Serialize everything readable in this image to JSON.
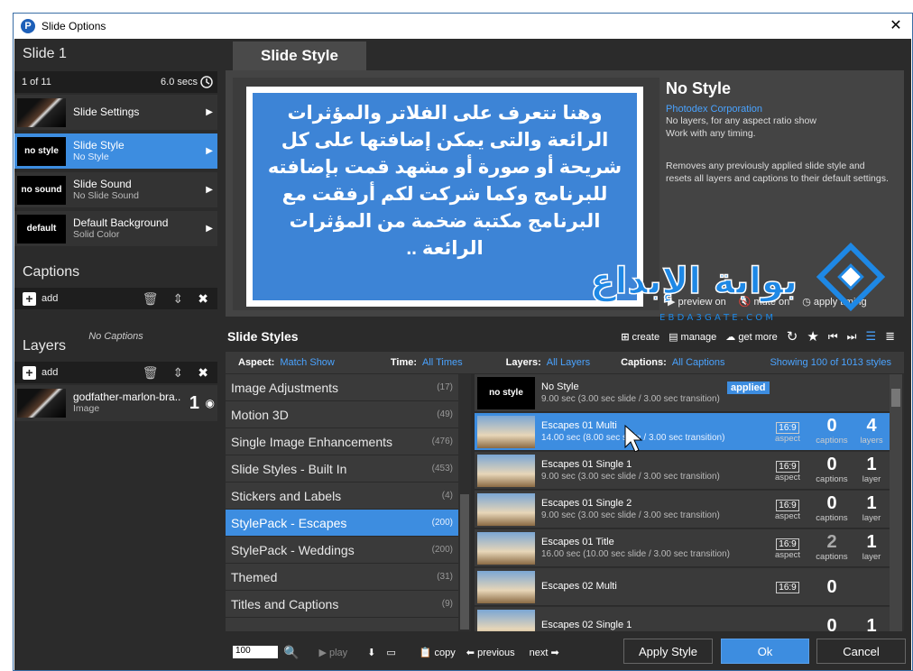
{
  "window": {
    "title": "Slide Options",
    "close": "✕"
  },
  "left": {
    "slide_title": "Slide 1",
    "slide_pos": "1 of 11",
    "slide_time": "6.0 secs",
    "nav": [
      {
        "thumb": "",
        "label": "Slide Settings",
        "sub": ""
      },
      {
        "thumb": "no style",
        "label": "Slide Style",
        "sub": "No Style"
      },
      {
        "thumb": "no sound",
        "label": "Slide Sound",
        "sub": "No Slide Sound"
      },
      {
        "thumb": "default",
        "label": "Default Background",
        "sub": "Solid Color"
      }
    ],
    "captions_title": "Captions",
    "captions_add": "add",
    "no_captions": "No Captions",
    "layers_title": "Layers",
    "layers_add": "add",
    "layer": {
      "name": "godfather-marlon-bra...",
      "type": "Image",
      "num": "1"
    }
  },
  "tab": "Slide Style",
  "preview": {
    "text": "وهنا نتعرف على الفلاتر والمؤثرات الرائعة والتى يمكن إضافتها على كل شريحة أو صورة أو مشهد قمت بإضافته للبرنامج وكما شركت لكم أرفقت مع البرنامج مكتبة ضخمة من المؤثرات الرائعة ..",
    "style_name": "No Style",
    "company": "Photodex Corporation",
    "desc1": "No layers, for any aspect ratio show",
    "desc2": "Work with any timing.",
    "desc3": "Removes any previously applied slide style and resets all layers and captions to their default settings.",
    "preview_on": "preview on",
    "mute_on": "mute on",
    "apply_timing": "apply timing"
  },
  "styles": {
    "title": "Slide Styles",
    "create": "create",
    "manage": "manage",
    "get_more": "get more",
    "aspect_label": "Aspect:",
    "aspect_val": "Match Show",
    "time_label": "Time:",
    "time_val": "All Times",
    "layers_label": "Layers:",
    "layers_val": "All Layers",
    "captions_label": "Captions:",
    "captions_val": "All Captions",
    "showing": "Showing 100 of 1013 styles",
    "categories": [
      {
        "name": "Image Adjustments",
        "n": "(17)"
      },
      {
        "name": "Motion 3D",
        "n": "(49)"
      },
      {
        "name": "Single Image Enhancements",
        "n": "(476)"
      },
      {
        "name": "Slide Styles - Built In",
        "n": "(453)"
      },
      {
        "name": "Stickers and Labels",
        "n": "(4)"
      },
      {
        "name": "StylePack - Escapes",
        "n": "(200)"
      },
      {
        "name": "StylePack - Weddings",
        "n": "(200)"
      },
      {
        "name": "Themed",
        "n": "(31)"
      },
      {
        "name": "Titles and Captions",
        "n": "(9)"
      }
    ],
    "rows": [
      {
        "name": "No Style",
        "detail": "9.00 sec (3.00 sec slide / 3.00 sec transition)",
        "thumb": "no style",
        "applied": "applied"
      },
      {
        "name": "Escapes 01 Multi",
        "detail": "14.00 sec (8.00 sec slide / 3.00 sec transition)",
        "aspect": "16:9",
        "captions": "0",
        "layers": "4",
        "layers_lbl": "layers"
      },
      {
        "name": "Escapes 01 Single 1",
        "detail": "9.00 sec (3.00 sec slide / 3.00 sec transition)",
        "aspect": "16:9",
        "captions": "0",
        "layers": "1",
        "layers_lbl": "layer"
      },
      {
        "name": "Escapes 01 Single 2",
        "detail": "9.00 sec (3.00 sec slide / 3.00 sec transition)",
        "aspect": "16:9",
        "captions": "0",
        "layers": "1",
        "layers_lbl": "layer"
      },
      {
        "name": "Escapes 01 Title",
        "detail": "16.00 sec (10.00 sec slide / 3.00 sec transition)",
        "aspect": "16:9",
        "captions": "2",
        "layers": "1",
        "layers_lbl": "layer"
      },
      {
        "name": "Escapes 02 Multi",
        "detail": "",
        "aspect": "16:9",
        "captions": "0",
        "layers": "",
        "layers_lbl": ""
      },
      {
        "name": "Escapes 02 Single 1",
        "detail": "",
        "aspect": "",
        "captions": "0",
        "layers": "1",
        "layers_lbl": ""
      }
    ],
    "aspect_lbl": "aspect",
    "captions_lbl": "captions"
  },
  "bottom": {
    "zoom": "100",
    "play": "play",
    "copy": "copy",
    "previous": "previous",
    "next": "next",
    "apply": "Apply Style",
    "ok": "Ok",
    "cancel": "Cancel"
  },
  "watermark": {
    "arabic": "بوابة الإبداع",
    "latin": "E B D A 3 G A T E . C O M"
  }
}
